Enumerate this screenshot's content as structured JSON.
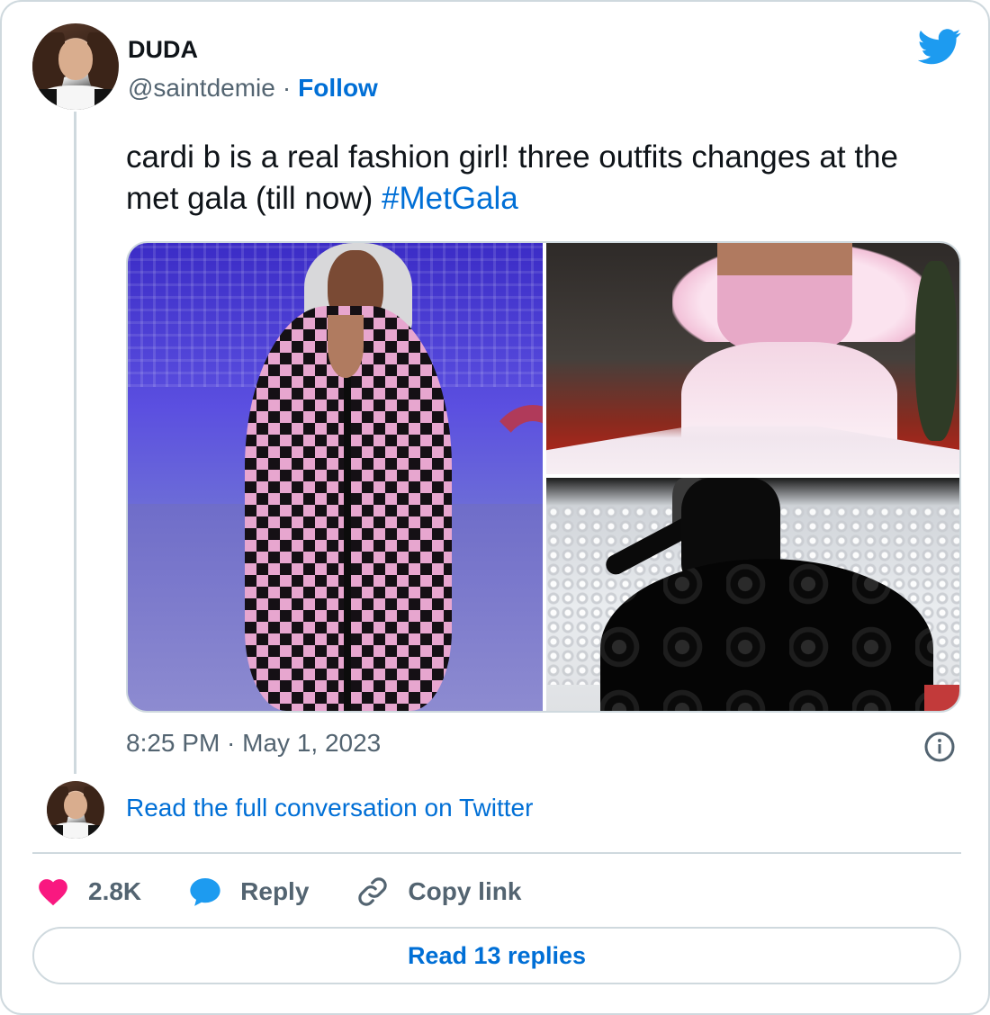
{
  "author": {
    "display_name": "DUDA",
    "handle": "@saintdemie",
    "separator": "·",
    "follow_label": "Follow"
  },
  "tweet": {
    "text": "cardi b is a real fashion girl! three outfits changes at the met gala (till now) ",
    "hashtag": "#MetGala",
    "timestamp": "8:25 PM · May 1, 2023"
  },
  "conversation": {
    "link_label": "Read the full conversation on Twitter"
  },
  "actions": {
    "like_count": "2.8K",
    "reply_label": "Reply",
    "copy_label": "Copy link"
  },
  "footer": {
    "read_replies_label": "Read 13 replies"
  },
  "icons": {
    "brand": "twitter-bird-icon",
    "like": "heart-icon",
    "reply": "speech-bubble-icon",
    "copy": "link-icon",
    "info": "info-icon"
  },
  "colors": {
    "link": "#006fd6",
    "heart": "#f91880",
    "reply": "#1d9bf0",
    "brand": "#1d9bf0",
    "muted": "#536471",
    "border": "#cfd9de"
  }
}
